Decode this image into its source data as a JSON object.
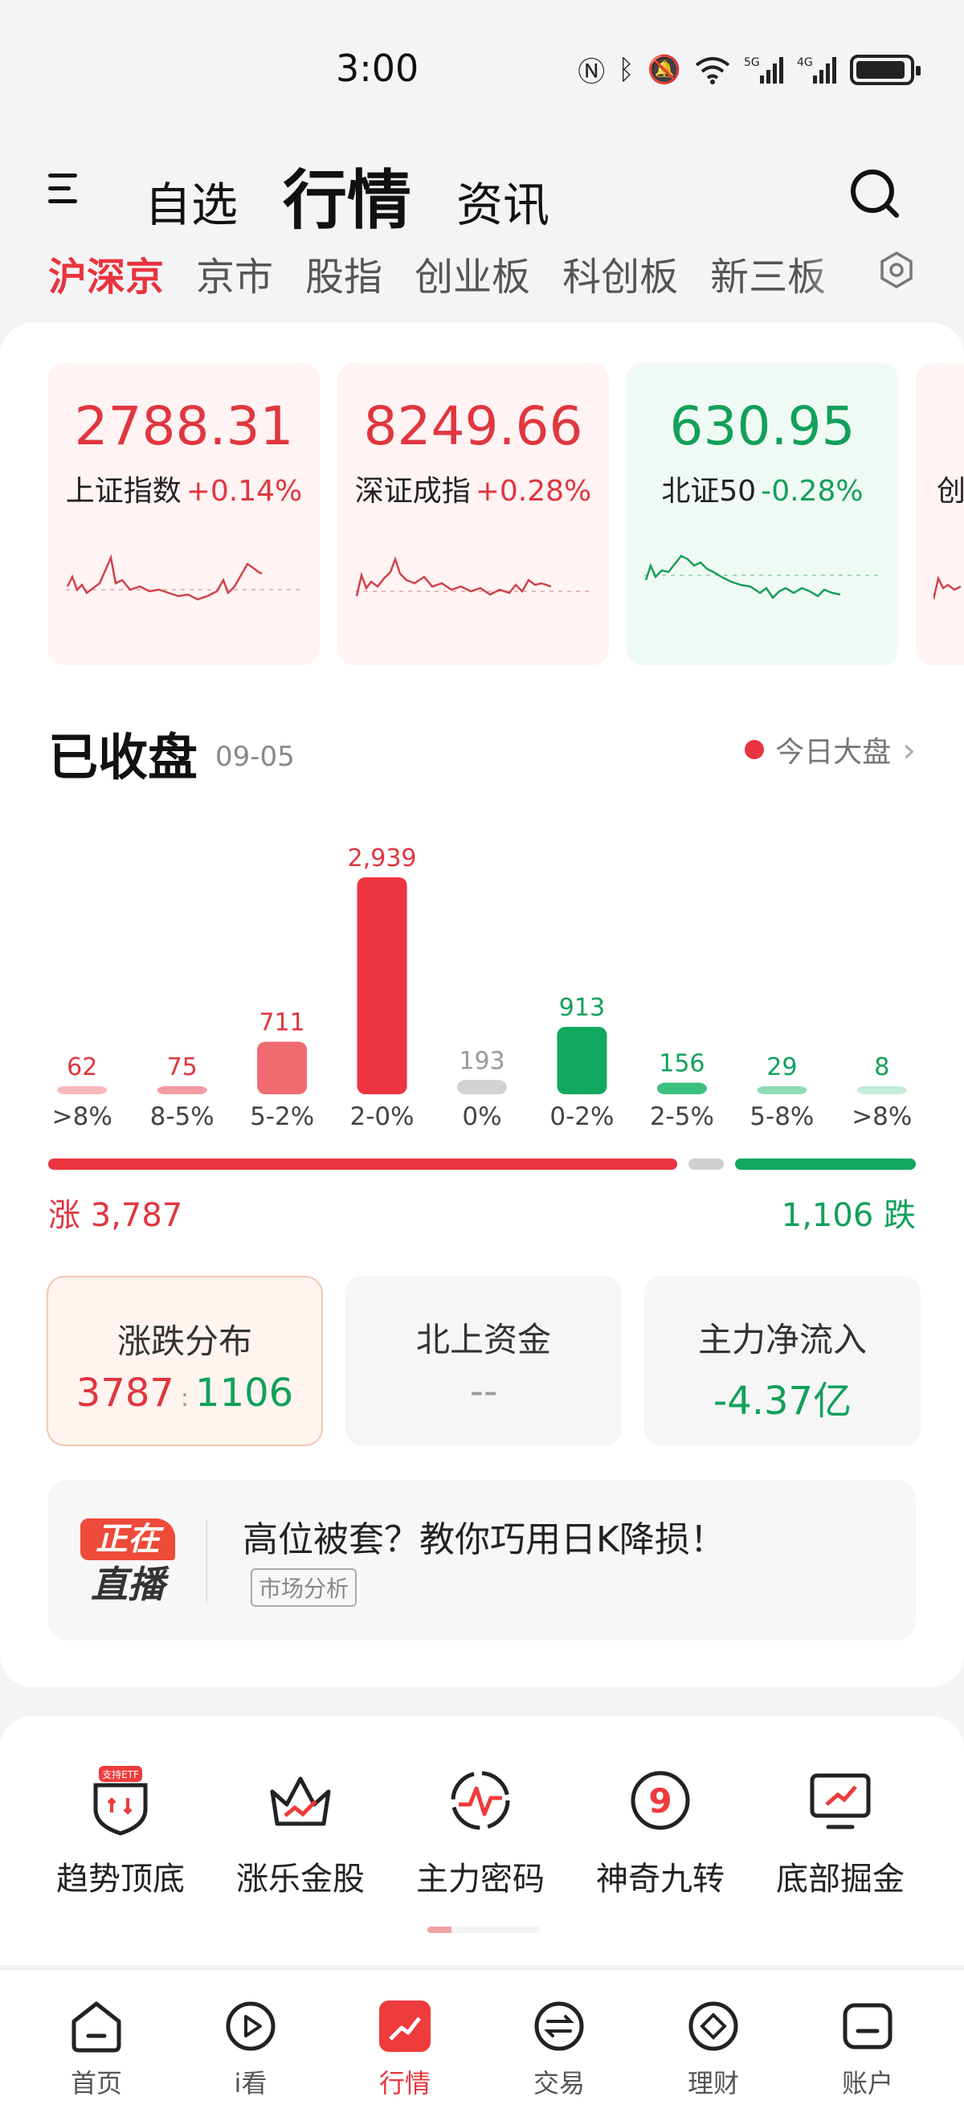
{
  "status": {
    "time": "3:00",
    "net1": "5G",
    "net2": "4G"
  },
  "top_tabs": [
    "自选",
    "行情",
    "资讯"
  ],
  "sub_tabs": [
    "沪深京",
    "京市",
    "股指",
    "创业板",
    "科创板",
    "新三板"
  ],
  "indices": [
    {
      "value": "2788.31",
      "name": "上证指数",
      "change": "+0.14%",
      "trend": "up"
    },
    {
      "value": "8249.66",
      "name": "深证成指",
      "change": "+0.28%",
      "trend": "up"
    },
    {
      "value": "630.95",
      "name": "北证50",
      "change": "-0.28%",
      "trend": "down"
    },
    {
      "value": "",
      "name": "创",
      "change": "",
      "trend": "up"
    }
  ],
  "closed": {
    "title": "已收盘",
    "date": "09-05",
    "link": "今日大盘"
  },
  "chart_data": {
    "type": "bar",
    "categories": [
      ">8%",
      "8-5%",
      "5-2%",
      "2-0%",
      "0%",
      "0-2%",
      "2-5%",
      "5-8%",
      ">8%"
    ],
    "values": [
      62,
      75,
      711,
      2939,
      193,
      913,
      156,
      29,
      8
    ],
    "labels": [
      "62",
      "75",
      "711",
      "2,939",
      "193",
      "913",
      "156",
      "29",
      "8"
    ],
    "groups": [
      "up",
      "up",
      "up",
      "up",
      "flat",
      "down",
      "down",
      "down",
      "down"
    ],
    "colors": {
      "up": "#ec3540",
      "flat": "#d2d2d2",
      "down": "#10a95e"
    },
    "ylim": [
      0,
      2939
    ]
  },
  "totals": {
    "up_label": "涨 3,787",
    "down_label": "1,106 跌",
    "up": 3787,
    "flat": 193,
    "down": 1106
  },
  "stats": [
    {
      "title": "涨跌分布",
      "up": "3787",
      "sep": ":",
      "down": "1106"
    },
    {
      "title": "北上资金",
      "value": "--"
    },
    {
      "title": "主力净流入",
      "value": "-4.37亿"
    }
  ],
  "live": {
    "badge_top": "正在",
    "badge_bottom": "直播",
    "title": "高位被套？教你巧用日K降损！",
    "tag": "市场分析"
  },
  "tools": [
    {
      "label": "趋势顶底",
      "badge": "支持ETF"
    },
    {
      "label": "涨乐金股"
    },
    {
      "label": "主力密码"
    },
    {
      "label": "神奇九转",
      "glyph": "9"
    },
    {
      "label": "底部掘金"
    }
  ],
  "bottom_nav": [
    "首页",
    "i看",
    "行情",
    "交易",
    "理财",
    "账户"
  ]
}
